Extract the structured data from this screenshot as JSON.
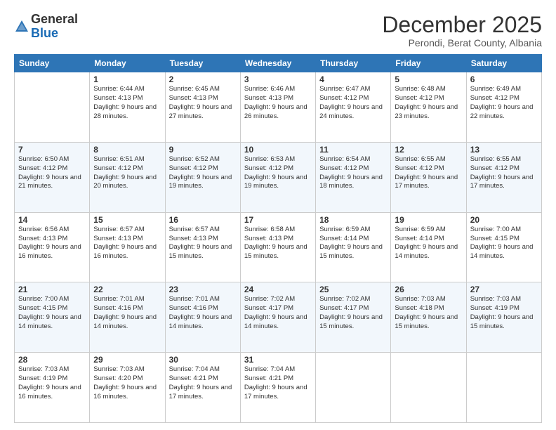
{
  "logo": {
    "general": "General",
    "blue": "Blue"
  },
  "header": {
    "month": "December 2025",
    "location": "Perondi, Berat County, Albania"
  },
  "days_of_week": [
    "Sunday",
    "Monday",
    "Tuesday",
    "Wednesday",
    "Thursday",
    "Friday",
    "Saturday"
  ],
  "weeks": [
    [
      {
        "day": "",
        "sunrise": "",
        "sunset": "",
        "daylight": ""
      },
      {
        "day": "1",
        "sunrise": "Sunrise: 6:44 AM",
        "sunset": "Sunset: 4:13 PM",
        "daylight": "Daylight: 9 hours and 28 minutes."
      },
      {
        "day": "2",
        "sunrise": "Sunrise: 6:45 AM",
        "sunset": "Sunset: 4:13 PM",
        "daylight": "Daylight: 9 hours and 27 minutes."
      },
      {
        "day": "3",
        "sunrise": "Sunrise: 6:46 AM",
        "sunset": "Sunset: 4:13 PM",
        "daylight": "Daylight: 9 hours and 26 minutes."
      },
      {
        "day": "4",
        "sunrise": "Sunrise: 6:47 AM",
        "sunset": "Sunset: 4:12 PM",
        "daylight": "Daylight: 9 hours and 24 minutes."
      },
      {
        "day": "5",
        "sunrise": "Sunrise: 6:48 AM",
        "sunset": "Sunset: 4:12 PM",
        "daylight": "Daylight: 9 hours and 23 minutes."
      },
      {
        "day": "6",
        "sunrise": "Sunrise: 6:49 AM",
        "sunset": "Sunset: 4:12 PM",
        "daylight": "Daylight: 9 hours and 22 minutes."
      }
    ],
    [
      {
        "day": "7",
        "sunrise": "Sunrise: 6:50 AM",
        "sunset": "Sunset: 4:12 PM",
        "daylight": "Daylight: 9 hours and 21 minutes."
      },
      {
        "day": "8",
        "sunrise": "Sunrise: 6:51 AM",
        "sunset": "Sunset: 4:12 PM",
        "daylight": "Daylight: 9 hours and 20 minutes."
      },
      {
        "day": "9",
        "sunrise": "Sunrise: 6:52 AM",
        "sunset": "Sunset: 4:12 PM",
        "daylight": "Daylight: 9 hours and 19 minutes."
      },
      {
        "day": "10",
        "sunrise": "Sunrise: 6:53 AM",
        "sunset": "Sunset: 4:12 PM",
        "daylight": "Daylight: 9 hours and 19 minutes."
      },
      {
        "day": "11",
        "sunrise": "Sunrise: 6:54 AM",
        "sunset": "Sunset: 4:12 PM",
        "daylight": "Daylight: 9 hours and 18 minutes."
      },
      {
        "day": "12",
        "sunrise": "Sunrise: 6:55 AM",
        "sunset": "Sunset: 4:12 PM",
        "daylight": "Daylight: 9 hours and 17 minutes."
      },
      {
        "day": "13",
        "sunrise": "Sunrise: 6:55 AM",
        "sunset": "Sunset: 4:12 PM",
        "daylight": "Daylight: 9 hours and 17 minutes."
      }
    ],
    [
      {
        "day": "14",
        "sunrise": "Sunrise: 6:56 AM",
        "sunset": "Sunset: 4:13 PM",
        "daylight": "Daylight: 9 hours and 16 minutes."
      },
      {
        "day": "15",
        "sunrise": "Sunrise: 6:57 AM",
        "sunset": "Sunset: 4:13 PM",
        "daylight": "Daylight: 9 hours and 16 minutes."
      },
      {
        "day": "16",
        "sunrise": "Sunrise: 6:57 AM",
        "sunset": "Sunset: 4:13 PM",
        "daylight": "Daylight: 9 hours and 15 minutes."
      },
      {
        "day": "17",
        "sunrise": "Sunrise: 6:58 AM",
        "sunset": "Sunset: 4:13 PM",
        "daylight": "Daylight: 9 hours and 15 minutes."
      },
      {
        "day": "18",
        "sunrise": "Sunrise: 6:59 AM",
        "sunset": "Sunset: 4:14 PM",
        "daylight": "Daylight: 9 hours and 15 minutes."
      },
      {
        "day": "19",
        "sunrise": "Sunrise: 6:59 AM",
        "sunset": "Sunset: 4:14 PM",
        "daylight": "Daylight: 9 hours and 14 minutes."
      },
      {
        "day": "20",
        "sunrise": "Sunrise: 7:00 AM",
        "sunset": "Sunset: 4:15 PM",
        "daylight": "Daylight: 9 hours and 14 minutes."
      }
    ],
    [
      {
        "day": "21",
        "sunrise": "Sunrise: 7:00 AM",
        "sunset": "Sunset: 4:15 PM",
        "daylight": "Daylight: 9 hours and 14 minutes."
      },
      {
        "day": "22",
        "sunrise": "Sunrise: 7:01 AM",
        "sunset": "Sunset: 4:16 PM",
        "daylight": "Daylight: 9 hours and 14 minutes."
      },
      {
        "day": "23",
        "sunrise": "Sunrise: 7:01 AM",
        "sunset": "Sunset: 4:16 PM",
        "daylight": "Daylight: 9 hours and 14 minutes."
      },
      {
        "day": "24",
        "sunrise": "Sunrise: 7:02 AM",
        "sunset": "Sunset: 4:17 PM",
        "daylight": "Daylight: 9 hours and 14 minutes."
      },
      {
        "day": "25",
        "sunrise": "Sunrise: 7:02 AM",
        "sunset": "Sunset: 4:17 PM",
        "daylight": "Daylight: 9 hours and 15 minutes."
      },
      {
        "day": "26",
        "sunrise": "Sunrise: 7:03 AM",
        "sunset": "Sunset: 4:18 PM",
        "daylight": "Daylight: 9 hours and 15 minutes."
      },
      {
        "day": "27",
        "sunrise": "Sunrise: 7:03 AM",
        "sunset": "Sunset: 4:19 PM",
        "daylight": "Daylight: 9 hours and 15 minutes."
      }
    ],
    [
      {
        "day": "28",
        "sunrise": "Sunrise: 7:03 AM",
        "sunset": "Sunset: 4:19 PM",
        "daylight": "Daylight: 9 hours and 16 minutes."
      },
      {
        "day": "29",
        "sunrise": "Sunrise: 7:03 AM",
        "sunset": "Sunset: 4:20 PM",
        "daylight": "Daylight: 9 hours and 16 minutes."
      },
      {
        "day": "30",
        "sunrise": "Sunrise: 7:04 AM",
        "sunset": "Sunset: 4:21 PM",
        "daylight": "Daylight: 9 hours and 17 minutes."
      },
      {
        "day": "31",
        "sunrise": "Sunrise: 7:04 AM",
        "sunset": "Sunset: 4:21 PM",
        "daylight": "Daylight: 9 hours and 17 minutes."
      },
      {
        "day": "",
        "sunrise": "",
        "sunset": "",
        "daylight": ""
      },
      {
        "day": "",
        "sunrise": "",
        "sunset": "",
        "daylight": ""
      },
      {
        "day": "",
        "sunrise": "",
        "sunset": "",
        "daylight": ""
      }
    ]
  ]
}
